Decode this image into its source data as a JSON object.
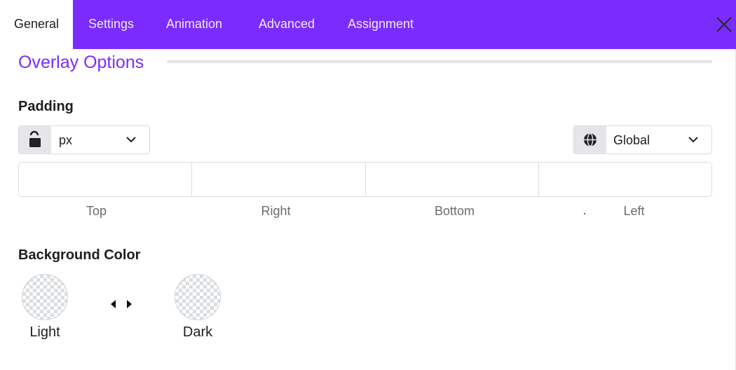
{
  "tabs": [
    {
      "label": "General",
      "active": true
    },
    {
      "label": "Settings",
      "active": false
    },
    {
      "label": "Animation",
      "active": false
    },
    {
      "label": "Advanced",
      "active": false
    },
    {
      "label": "Assignment",
      "active": false
    }
  ],
  "accent_color": "#7a2cff",
  "section": {
    "title": "Overlay Options"
  },
  "padding": {
    "label": "Padding",
    "unit": {
      "value": "px",
      "lock_icon": "lock-open-icon"
    },
    "scope": {
      "value": "Global",
      "icon": "globe-icon"
    },
    "fields": [
      {
        "label": "Top",
        "value": ""
      },
      {
        "label": "Right",
        "value": ""
      },
      {
        "label": "Bottom",
        "value": ""
      },
      {
        "label": "Left",
        "value": ""
      }
    ]
  },
  "background_color": {
    "label": "Background Color",
    "light_label": "Light",
    "dark_label": "Dark"
  }
}
